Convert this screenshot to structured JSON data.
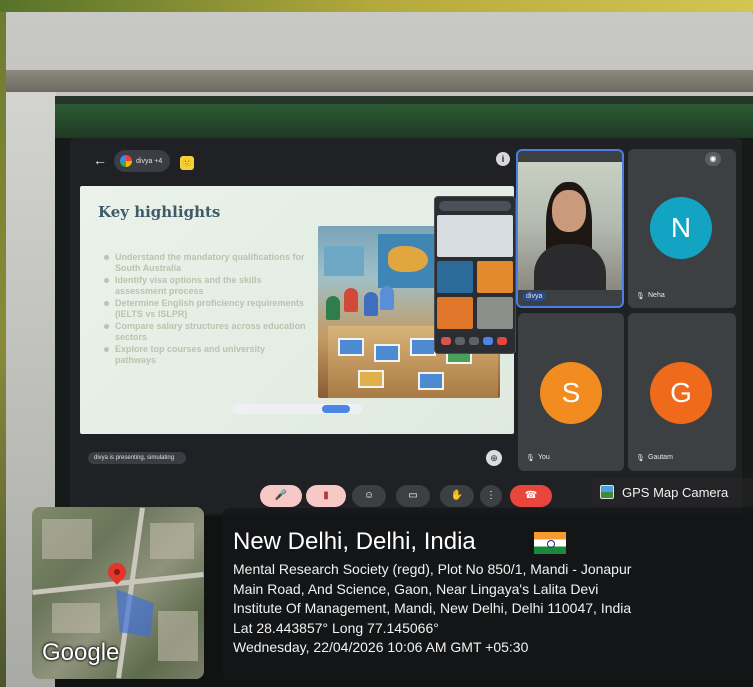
{
  "meeting": {
    "badge_label": "divya +4",
    "emoji": "🙂",
    "presenting_text": "divya is presenting, simulating",
    "tiles": [
      {
        "name": "divya",
        "initial": "",
        "color": ""
      },
      {
        "name": "Neha",
        "initial": "N",
        "color": "#12a4c2"
      },
      {
        "name": "You",
        "initial": "S",
        "color": "#f28b20"
      },
      {
        "name": "Gautam",
        "initial": "G",
        "color": "#f06a1c"
      }
    ],
    "icons": {
      "back": "←",
      "info": "i",
      "speaker": "◉",
      "layout": "⊕"
    }
  },
  "slide": {
    "title": "Key highlights",
    "bullets": [
      "Understand the mandatory qualifications for South Australia",
      "Identify visa options and the skills assessment process",
      "Determine English proficiency requirements (IELTS vs ISLPR)",
      "Compare salary structures across education sectors",
      "Explore top courses and university pathways"
    ]
  },
  "controls": [
    {
      "name": "mic-off-button",
      "label": "🎤",
      "color": "#f6c9c6"
    },
    {
      "name": "camera-button",
      "label": "▮",
      "color": "#f6c9c6"
    },
    {
      "name": "emoji-button",
      "label": "☺",
      "color": "#3c4043"
    },
    {
      "name": "present-button",
      "label": "▭",
      "color": "#3c4043"
    },
    {
      "name": "raise-hand-button",
      "label": "✋",
      "color": "#3c4043"
    },
    {
      "name": "more-button",
      "label": "⋮",
      "color": "#3c4043"
    },
    {
      "name": "leave-call-button",
      "label": "☎",
      "color": "#e8453c"
    }
  ],
  "gps": {
    "app_label": "GPS Map Camera",
    "map_logo": "Google",
    "city": "New Delhi, Delhi, India",
    "address_lines": [
      "Mental Research Society (regd), Plot No 850/1, Mandi - Jonapur",
      "Main Road, And Science, Gaon, Near Lingaya's Lalita Devi",
      "Institute Of Management, Mandi, New Delhi, Delhi 110047, India",
      "Lat 28.443857° Long 77.145066°",
      "Wednesday, 22/04/2026 10:06 AM GMT +05:30"
    ]
  }
}
